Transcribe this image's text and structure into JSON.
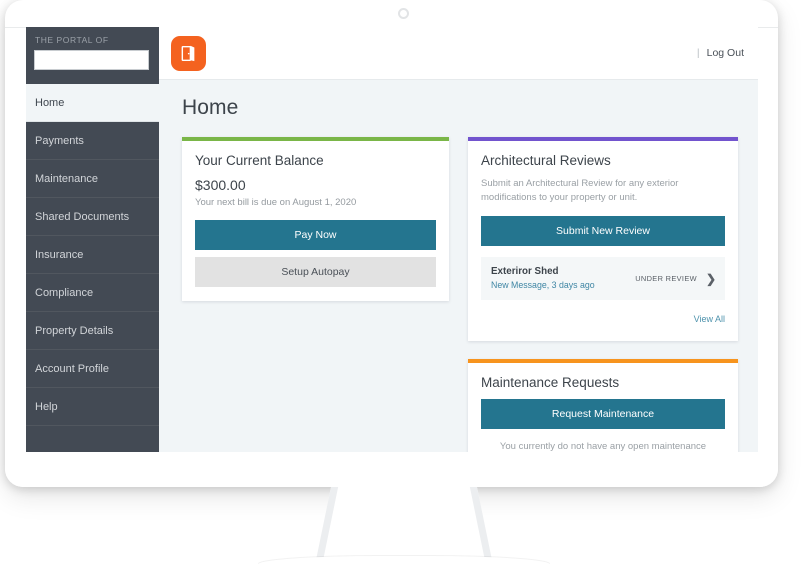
{
  "device": {
    "camera_icon": "camera-dot"
  },
  "sidebar": {
    "brand_kicker": "THE PORTAL OF",
    "logo_placeholder": "",
    "items": [
      {
        "label": "Home",
        "active": true
      },
      {
        "label": "Payments",
        "active": false
      },
      {
        "label": "Maintenance",
        "active": false
      },
      {
        "label": "Shared Documents",
        "active": false
      },
      {
        "label": "Insurance",
        "active": false
      },
      {
        "label": "Compliance",
        "active": false
      },
      {
        "label": "Property Details",
        "active": false
      },
      {
        "label": "Account Profile",
        "active": false
      },
      {
        "label": "Help",
        "active": false
      }
    ]
  },
  "topbar": {
    "logo_icon": "open-door-icon",
    "divider": "|",
    "logout_label": "Log Out"
  },
  "page": {
    "title": "Home"
  },
  "cards": {
    "balance": {
      "accent_color": "#7AB648",
      "title": "Your Current Balance",
      "amount": "$300.00",
      "due_note": "Your next bill is due on August 1, 2020",
      "primary_button": "Pay Now",
      "secondary_button": "Setup Autopay"
    },
    "architectural": {
      "accent_color": "#7254CE",
      "title": "Architectural Reviews",
      "description": "Submit an Architectural Review for any exterior modifications to your property or unit.",
      "primary_button": "Submit New Review",
      "review": {
        "name": "Exteriror Shed",
        "meta": "New Message, 3 days ago",
        "status": "UNDER REVIEW",
        "chevron_icon": "chevron-right-icon"
      },
      "view_all": "View All"
    },
    "maintenance": {
      "accent_color": "#F7941E",
      "title": "Maintenance Requests",
      "primary_button": "Request Maintenance",
      "empty_message": "You currently do not have any open maintenance requests."
    }
  }
}
